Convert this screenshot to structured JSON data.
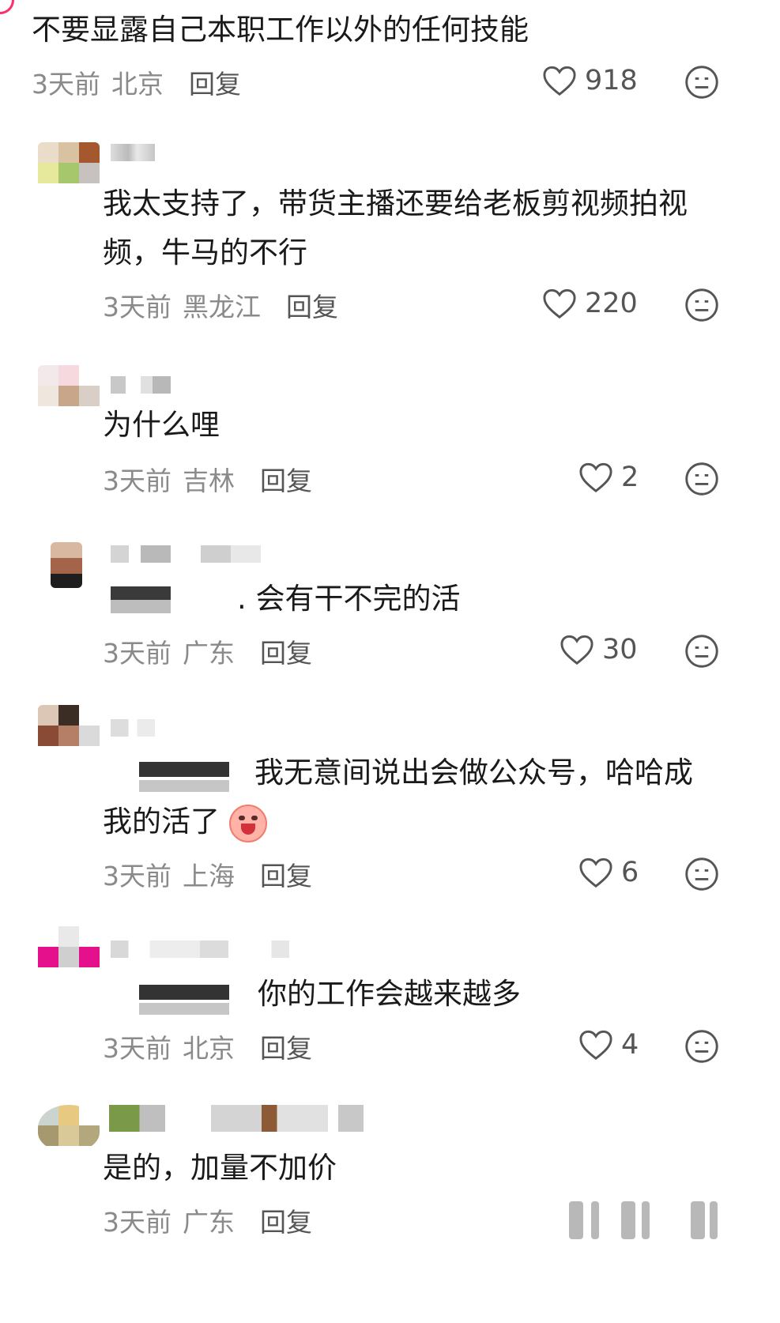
{
  "top_comment": {
    "text": "不要显露自己本职工作以外的任何技能",
    "time": "3天前",
    "location": "北京",
    "reply_label": "回复",
    "likes": "918"
  },
  "replies": [
    {
      "text": "我太支持了，带货主播还要给老板剪视频拍视",
      "text2": "频，牛马的不行",
      "time": "3天前",
      "location": "黑龙江",
      "reply_label": "回复",
      "likes": "220"
    },
    {
      "text": "为什么哩",
      "time": "3天前",
      "location": "吉林",
      "reply_label": "回复",
      "likes": "2"
    },
    {
      "text": ". 会有干不完的活",
      "time": "3天前",
      "location": "广东",
      "reply_label": "回复",
      "likes": "30"
    },
    {
      "text": "我无意间说出会做公众号，哈哈成",
      "text2": "我的活了",
      "time": "3天前",
      "location": "上海",
      "reply_label": "回复",
      "likes": "6"
    },
    {
      "text": "你的工作会越来越多",
      "time": "3天前",
      "location": "北京",
      "reply_label": "回复",
      "likes": "4"
    },
    {
      "text": "是的，加量不加价",
      "time": "3天前",
      "location": "广东",
      "reply_label": "回复"
    }
  ],
  "icons": {
    "like": "heart-outline-icon",
    "dislike": "neutral-face-icon",
    "emoji": "laughing-cry-emoji-icon"
  },
  "colors": {
    "accent": "#ff2d6b",
    "meta": "#8a8a8a",
    "text": "#1a1a1a"
  }
}
